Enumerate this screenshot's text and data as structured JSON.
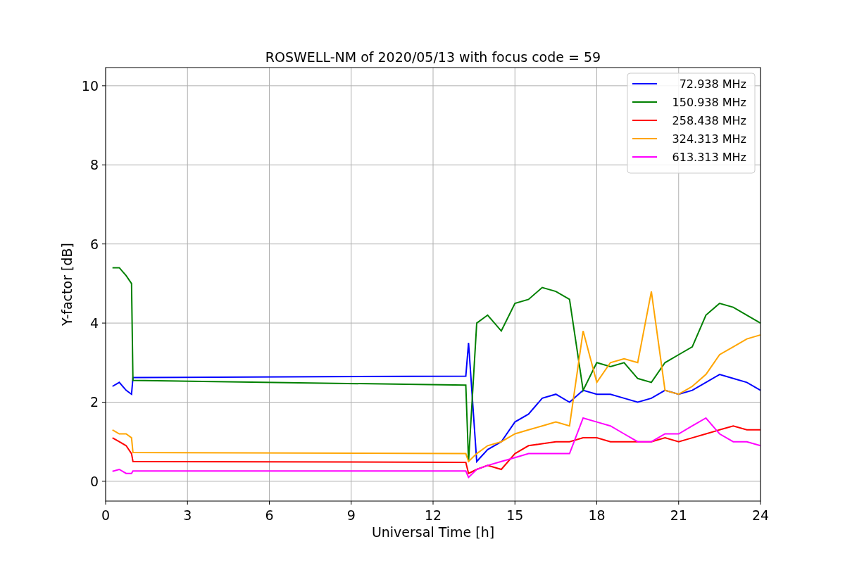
{
  "chart_data": {
    "type": "line",
    "title": "ROSWELL-NM of 2020/05/13 with focus code = 59",
    "xlabel": "Universal Time [h]",
    "ylabel": "Y-factor [dB]",
    "x": [
      0.25,
      0.5,
      0.75,
      0.95,
      1.0,
      13.2,
      13.3,
      13.6,
      14,
      14.5,
      15,
      15.5,
      16,
      16.5,
      17,
      17.5,
      18,
      18.5,
      19,
      19.5,
      20,
      20.5,
      21,
      21.5,
      22,
      22.5,
      23,
      23.5,
      24
    ],
    "series": [
      {
        "name": "72.938 MHz",
        "color": "#0000ff",
        "values": [
          2.4,
          2.5,
          2.3,
          2.2,
          2.62,
          2.66,
          3.5,
          0.5,
          0.8,
          1.0,
          1.5,
          1.7,
          2.1,
          2.2,
          2.0,
          2.3,
          2.2,
          2.2,
          2.1,
          2.0,
          2.1,
          2.3,
          2.2,
          2.3,
          2.5,
          2.7,
          2.6,
          2.5,
          2.3
        ]
      },
      {
        "name": "150.938 MHz",
        "color": "#008000",
        "values": [
          5.4,
          5.4,
          5.2,
          5.0,
          2.55,
          2.43,
          0.5,
          4.0,
          4.2,
          3.8,
          4.5,
          4.6,
          4.9,
          4.8,
          4.6,
          2.3,
          3.0,
          2.9,
          3.0,
          2.6,
          2.5,
          3.0,
          3.2,
          3.4,
          4.2,
          4.5,
          4.4,
          4.2,
          4.0
        ]
      },
      {
        "name": "258.438 MHz",
        "color": "#ff0000",
        "values": [
          1.1,
          1.0,
          0.9,
          0.7,
          0.5,
          0.48,
          0.2,
          0.3,
          0.4,
          0.3,
          0.7,
          0.9,
          0.95,
          1.0,
          1.0,
          1.1,
          1.1,
          1.0,
          1.0,
          1.0,
          1.0,
          1.1,
          1.0,
          1.1,
          1.2,
          1.3,
          1.4,
          1.3,
          1.3
        ]
      },
      {
        "name": "324.313 MHz",
        "color": "#ffa500",
        "values": [
          1.3,
          1.2,
          1.2,
          1.1,
          0.73,
          0.7,
          0.5,
          0.7,
          0.9,
          1.0,
          1.2,
          1.3,
          1.4,
          1.5,
          1.4,
          3.8,
          2.5,
          3.0,
          3.1,
          3.0,
          4.8,
          2.3,
          2.2,
          2.4,
          2.7,
          3.2,
          3.4,
          3.6,
          3.7
        ]
      },
      {
        "name": "613.313 MHz",
        "color": "#ff00ff",
        "values": [
          0.25,
          0.3,
          0.2,
          0.2,
          0.26,
          0.26,
          0.1,
          0.3,
          0.4,
          0.5,
          0.6,
          0.7,
          0.7,
          0.7,
          0.7,
          1.6,
          1.5,
          1.4,
          1.2,
          1.0,
          1.0,
          1.2,
          1.2,
          1.4,
          1.6,
          1.2,
          1.0,
          1.0,
          0.9
        ]
      }
    ],
    "grid": true,
    "legend": true,
    "xlim": [
      0,
      24
    ],
    "ylim": [
      -0.5,
      10.46
    ],
    "xticks": [
      0,
      3,
      6,
      9,
      12,
      15,
      18,
      21,
      24
    ],
    "yticks": [
      0,
      2,
      4,
      6,
      8,
      10
    ]
  }
}
